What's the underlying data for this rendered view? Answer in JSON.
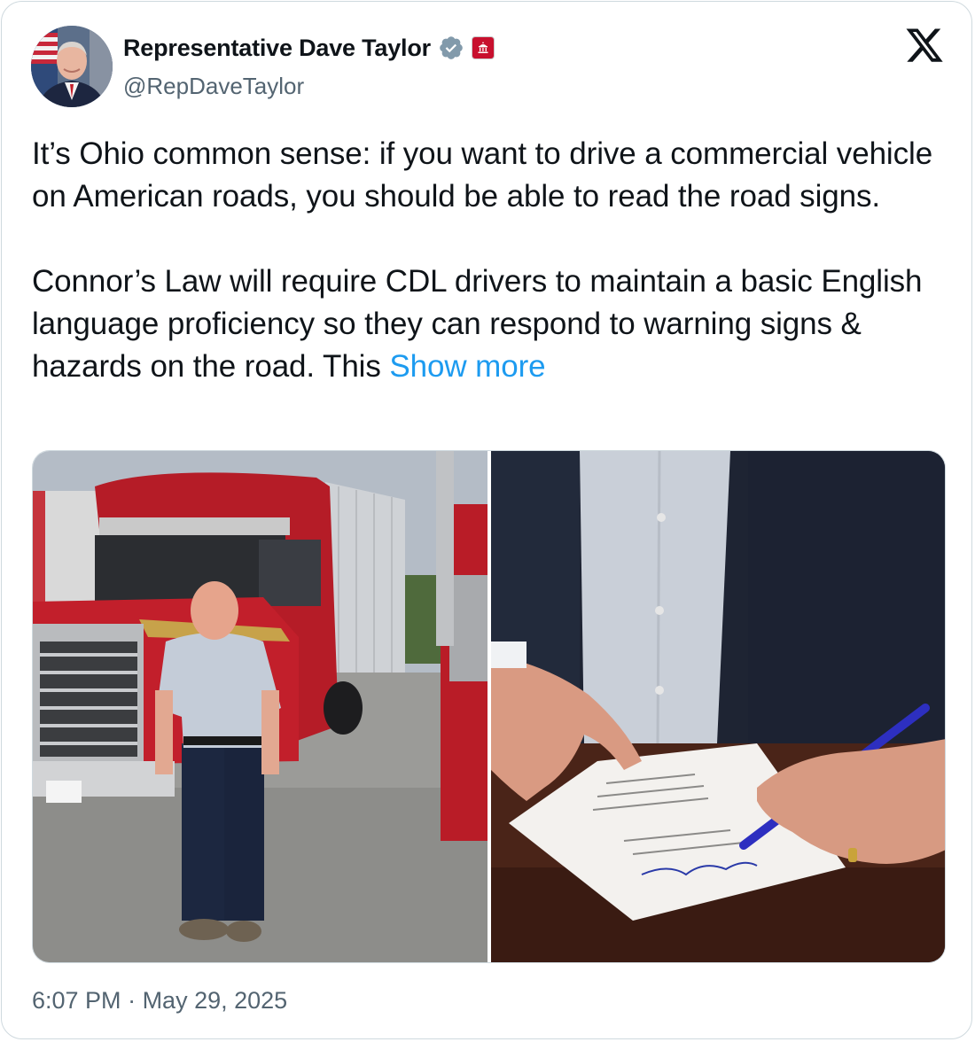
{
  "author": {
    "display_name": "Representative Dave Taylor",
    "handle": "@RepDaveTaylor",
    "verified": true,
    "verified_icon": "verified-badge-icon",
    "affiliation_icon": "government-badge-icon",
    "avatar_icon": "profile-photo"
  },
  "platform": {
    "logo": "x-logo-icon"
  },
  "tweet": {
    "paragraph_1": "It’s Ohio common sense: if you want to drive a commercial vehicle on American roads, you should be able to read the road signs.",
    "paragraph_2": "Connor’s Law will require CDL drivers to maintain a basic English language proficiency so they can respond to warning signs & hazards on the road. This",
    "show_more_label": " Show more"
  },
  "media": {
    "photo_1": "man-standing-by-red-semi-truck",
    "photo_2": "hands-signing-bill"
  },
  "meta": {
    "time": "6:07 PM",
    "separator": " · ",
    "date": "May 29, 2025"
  },
  "colors": {
    "text": "#0f1419",
    "secondary": "#536471",
    "link": "#1d9bf0",
    "border": "#cfd9de",
    "verified": "#829aab",
    "gov_badge": "#c8102e"
  }
}
